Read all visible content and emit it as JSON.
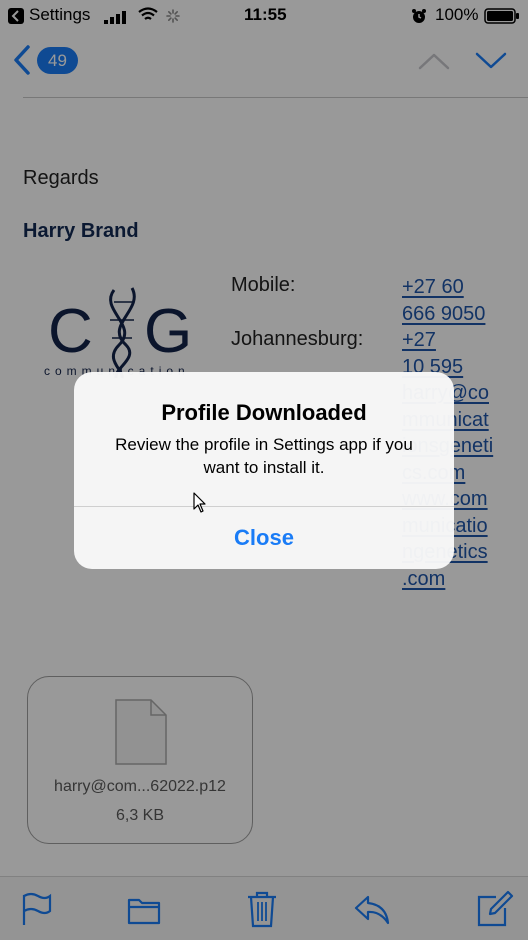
{
  "status_bar": {
    "back_app": "Settings",
    "time": "11:55",
    "battery": "100%"
  },
  "nav": {
    "unread_count": "49"
  },
  "email": {
    "greeting": "Regards",
    "sender_name": "Harry Brand",
    "logo_text": "communication",
    "contacts": [
      {
        "label": "Mobile:",
        "lines": [
          "+27 60",
          "666 9050"
        ]
      },
      {
        "label": "Johannesburg:",
        "lines": [
          "+27",
          "10 595"
        ]
      }
    ],
    "email_lines": [
      "harry@co",
      "mmunicat",
      "ionsgeneti",
      "cs.com",
      "www.com",
      "municatio",
      "ngenetics",
      ".com"
    ]
  },
  "attachment": {
    "filename": "harry@com...62022.p12",
    "size": "6,3 KB"
  },
  "alert": {
    "title": "Profile Downloaded",
    "message": "Review the profile in Settings app if you want to install it.",
    "button_label": "Close"
  },
  "colors": {
    "accent": "#1a7cf6",
    "sender_name": "#132a54",
    "link": "#1f55a8"
  }
}
